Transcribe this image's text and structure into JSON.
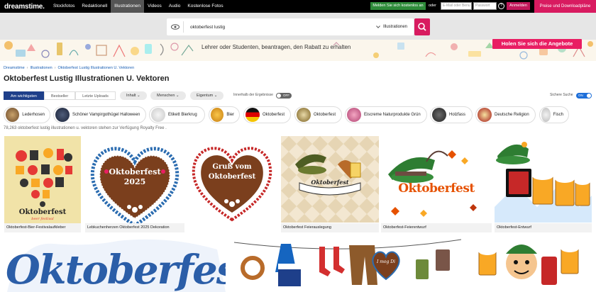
{
  "brand": {
    "logo_text": "dreamstime."
  },
  "nav": {
    "items": [
      "Stockfotos",
      "Redaktionell",
      "Illustrationen",
      "Videos",
      "Audio",
      "Kostenlose Fotos"
    ],
    "active": 2
  },
  "account": {
    "register_label": "Melden Sie sich kostenlos an",
    "or_label": "oder",
    "email_placeholder": "E-Mail oder Benu",
    "password_placeholder": "Passwort",
    "help_label": "?",
    "login_label": "Anmelden",
    "prices_label": "Preise und Downloadpläne"
  },
  "search": {
    "query": "oktoberfest lustig",
    "type_label": "Illustrationen",
    "eye_icon": "eye-icon",
    "search_icon": "search-icon"
  },
  "banner": {
    "text": "Lehrer oder Studenten, beantragen, den Rabatt zu erhalten",
    "button_label": "Holen Sie sich die Angebote"
  },
  "breadcrumb": [
    "Dreamstime",
    "Illustrationen",
    "Oktoberfest Lustig Illustrationen U. Vektoren"
  ],
  "page_title": "Oktoberfest Lustig Illustrationen U. Vektoren",
  "tabs": [
    "Am wichtigsten",
    "Bestseller",
    "Letzte Uploads"
  ],
  "filters": [
    "Inhalt",
    "Menschen",
    "Eigentum"
  ],
  "toggles": {
    "within_results": "Innerhalb der Ergebnisse",
    "within_state": "OFF",
    "safe_search": "Sichere Suche",
    "safe_state": "ON"
  },
  "chips": [
    "Lederhosen",
    "Schöner Vampirgothügel Halloween",
    "Etikett Bierkrug",
    "Bier",
    "Oktoberfest",
    "Oktoberfest",
    "Eiscreme Naturprodukte Grün",
    "Holzfass",
    "Deutsche Religion",
    "Fisch"
  ],
  "results_count": "78,263 oktoberfest lustig illustrationen u. vektoren stehen zur Verfügung Royalty Free .",
  "results": [
    {
      "caption": "Oktoberfest-Bier-Festivalaufkleber",
      "art_title": "Oktoberfest",
      "art_sub": "beer festival"
    },
    {
      "caption": "Lebkuchenherzen Oktoberfest 2025 Dekoration",
      "art_lines": [
        "Oktoberfest",
        "2025"
      ]
    },
    {
      "caption": "",
      "art_lines": [
        "Gruß vom",
        "Oktoberfest"
      ]
    },
    {
      "caption": "Oktoberfest Feierauslegung",
      "art_title": "Oktoberfest"
    },
    {
      "caption": "Oktoberfest-Feierentwurf",
      "art_title": "Oktoberfest"
    },
    {
      "caption": "Oktoberfest-Entwurf"
    }
  ],
  "second_row": {
    "lettering": "Oktoberfest",
    "heart_text": "I mog Di"
  },
  "colors": {
    "accent": "#d81b60",
    "nav_bg": "#000000",
    "tab_active": "#1e3f8a",
    "register": "#2e8b3a"
  }
}
